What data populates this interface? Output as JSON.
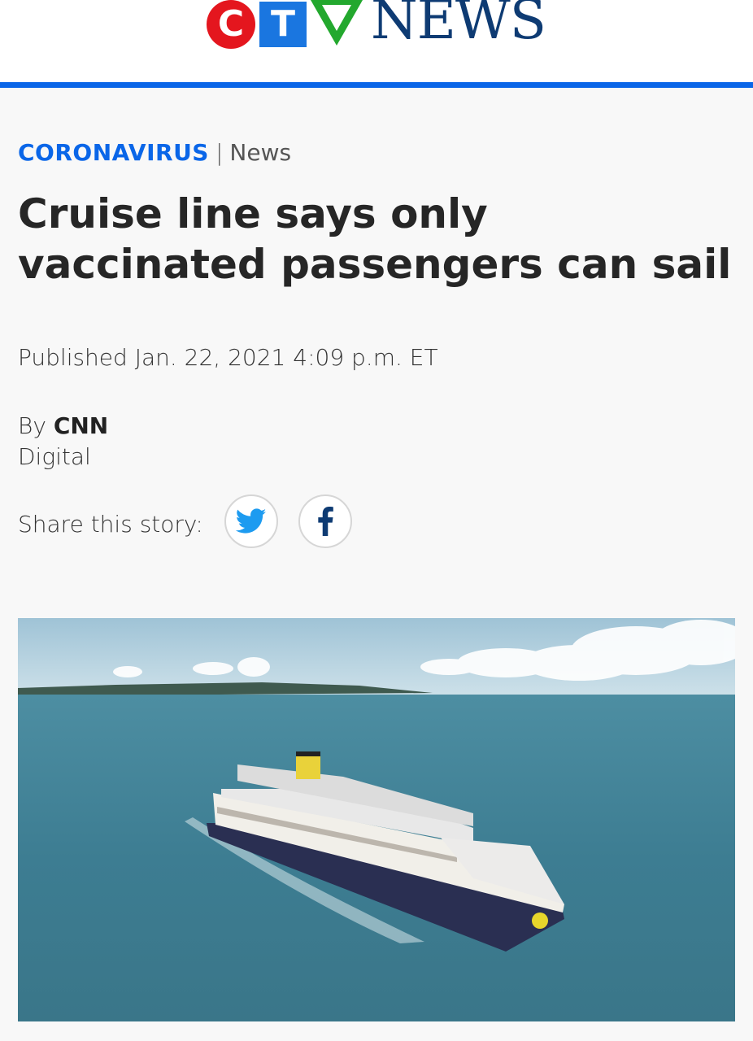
{
  "brand": {
    "logo_letters": [
      "C",
      "T",
      "V"
    ],
    "logo_word": "NEWS",
    "accent_color": "#0a66e8",
    "logo_colors": [
      "#e4161e",
      "#1a76e0",
      "#23a82e",
      "#0e3b73"
    ]
  },
  "article": {
    "category": "CORONAVIRUS",
    "separator": "|",
    "subcategory": "News",
    "headline": "Cruise line says only vaccinated passengers can sail",
    "published": "Published Jan. 22, 2021 4:09 p.m. ET",
    "byline_prefix": "By",
    "author": "CNN",
    "author_desk": "Digital"
  },
  "share": {
    "label": "Share this story:",
    "buttons": [
      {
        "network": "twitter",
        "icon": "twitter-icon"
      },
      {
        "network": "facebook",
        "icon": "facebook-icon"
      }
    ]
  },
  "hero_image": {
    "subject": "cruise-ship-at-sea"
  }
}
